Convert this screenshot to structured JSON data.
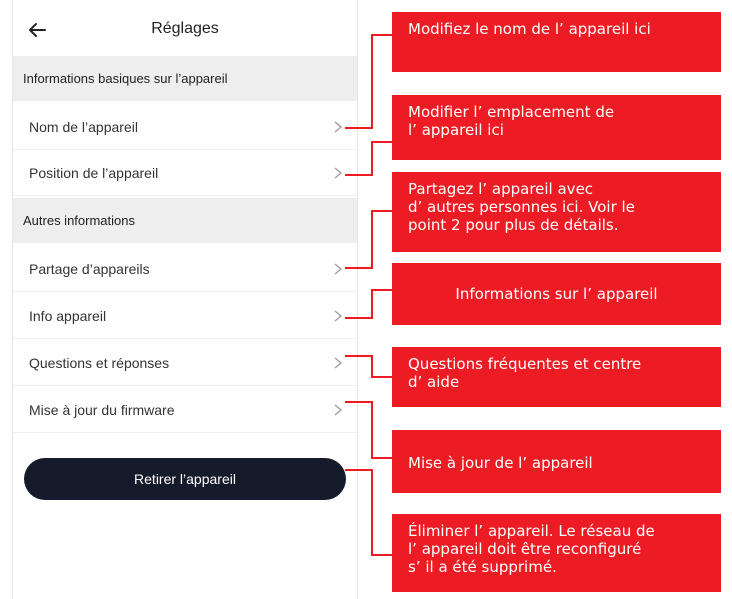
{
  "header": {
    "title": "Réglages",
    "back_icon": "back-arrow-icon"
  },
  "sections": {
    "basic": "Informations basiques sur l’appareil",
    "other": "Autres informations"
  },
  "rows": {
    "name": "Nom de l’appareil",
    "position": "Position de l’appareil",
    "share": "Partage d’appareils",
    "info": "Info appareil",
    "faq": "Questions et réponses",
    "firmware": "Mise à jour du firmware"
  },
  "remove_button": "Retirer l’appareil",
  "callouts": {
    "c1": [
      "Modifiez le nom de l’ appareil ici"
    ],
    "c2": [
      "Modifier l’ emplacement de",
      "l’ appareil ici"
    ],
    "c3": [
      "Partagez l’ appareil avec",
      "d’ autres personnes ici. Voir le",
      "point 2 pour plus de détails."
    ],
    "c4": [
      "Informations sur l’ appareil"
    ],
    "c5": [
      "Questions fréquentes et centre",
      "d’ aide"
    ],
    "c6": [
      "Mise à jour de l’ appareil"
    ],
    "c7": [
      "Éliminer l’ appareil. Le réseau de",
      "l’ appareil doit être reconfiguré",
      "s’ il a été supprimé."
    ]
  },
  "colors": {
    "callout": "#ed1c24",
    "button": "#161b2b",
    "section_bg": "#eeeeee"
  }
}
